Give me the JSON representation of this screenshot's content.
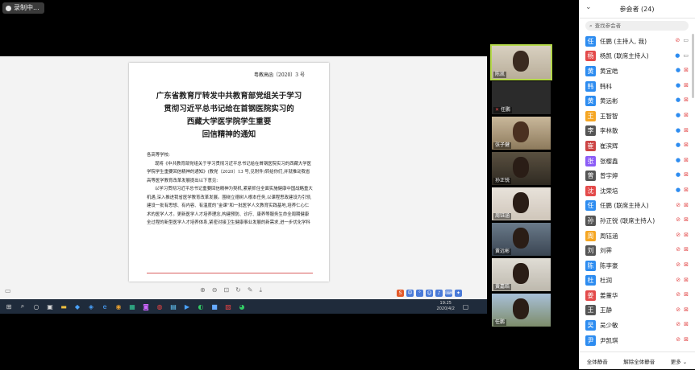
{
  "recording": {
    "label": "录制中..."
  },
  "document": {
    "number": "粤教高函〔2020〕3 号",
    "title": [
      "广东省教育厅转发中共教育部党组关于学习",
      "贯彻习近平总书记给在首钢医院实习的",
      "西藏大学医学院学生重要",
      "回信精神的通知"
    ],
    "salutation": "各高等学校:",
    "paragraphs": [
      "现将《中共教育部党组关于学习贯彻习近平总书记给在首钢医院实习的西藏大学医学院学生重要回信精神的通知》(教党〔2020〕13 号,见附件)转给你们,并就推动我省高等医学教育改革发展提出以下意见:",
      "以学习贯彻习近平总书记重要回信精神为契机,紧紧抓住全面实施健康中国战略重大机遇,深入推进我省医学教育改革发展。围绕立德树人根本任务,以课程思政建设为引领,建设一批有思想、有内容、有温度的“金课”和一批医学人文教育实践基地,培养仁心仁术的医学人才。更新医学人才培养理念,构建预防、诊疗、康养等服务生命全周期健康全过程的新型医学人才培养体系,紧密对接卫生健康事业发展的新需求,进一步优化学科"
    ]
  },
  "tray": {
    "time": "19:25",
    "date": "2020/4/2"
  },
  "videos": [
    {
      "name": "陈凯",
      "speaking": true
    },
    {
      "name": "任鹏",
      "speaking": false
    },
    {
      "name": "张子健",
      "speaking": false
    },
    {
      "name": "孙正锐",
      "speaking": false
    },
    {
      "name": "周钰涵",
      "speaking": false
    },
    {
      "name": "黄远彬",
      "speaking": false
    },
    {
      "name": "黄嘉皓",
      "speaking": false
    },
    {
      "name": "任鹏",
      "speaking": false
    }
  ],
  "panel": {
    "title": "参会者 (24)",
    "search_placeholder": "查找参会者",
    "participants": [
      {
        "avatar": "任",
        "name": "任鹏 (主持人, 我)",
        "color": "#2d8cf0",
        "mic": "muted",
        "cam": "on"
      },
      {
        "avatar": "杨",
        "name": "杨凯 (联席主持人)",
        "color": "#e34a4a",
        "mic": "on",
        "cam": "on"
      },
      {
        "avatar": "黄",
        "name": "黄宜皓",
        "color": "#2d8cf0",
        "mic": "on",
        "cam": "off"
      },
      {
        "avatar": "韩",
        "name": "韩科",
        "color": "#2d8cf0",
        "mic": "on",
        "cam": "off"
      },
      {
        "avatar": "黄",
        "name": "黄远彬",
        "color": "#2d8cf0",
        "mic": "on",
        "cam": "off"
      },
      {
        "avatar": "王",
        "name": "王智智",
        "color": "#f5a623",
        "mic": "on",
        "cam": "off"
      },
      {
        "avatar": "李",
        "name": "李林散",
        "color": "#555",
        "mic": "on",
        "cam": "off"
      },
      {
        "avatar": "崔",
        "name": "崔滨辉",
        "color": "#c44",
        "mic": "on",
        "cam": "off"
      },
      {
        "avatar": "张",
        "name": "张樱鑫",
        "color": "#8b5cf6",
        "mic": "on",
        "cam": "off"
      },
      {
        "avatar": "曾",
        "name": "曾宇婷",
        "color": "#555",
        "mic": "on",
        "cam": "off"
      },
      {
        "avatar": "沈",
        "name": "沈荣培",
        "color": "#e34a4a",
        "mic": "on",
        "cam": "off"
      },
      {
        "avatar": "任",
        "name": "任鹏 (联席主持人)",
        "color": "#2d8cf0",
        "mic": "muted",
        "cam": "off"
      },
      {
        "avatar": "孙",
        "name": "孙正锐 (联席主持人)",
        "color": "#555",
        "mic": "muted",
        "cam": "off"
      },
      {
        "avatar": "周",
        "name": "周钰涵",
        "color": "#f5a623",
        "mic": "muted",
        "cam": "off"
      },
      {
        "avatar": "刘",
        "name": "刘霁",
        "color": "#555",
        "mic": "muted",
        "cam": "off"
      },
      {
        "avatar": "陈",
        "name": "陈李豪",
        "color": "#2d8cf0",
        "mic": "muted",
        "cam": "off"
      },
      {
        "avatar": "杜",
        "name": "杜润",
        "color": "#2d8cf0",
        "mic": "muted",
        "cam": "off"
      },
      {
        "avatar": "姜",
        "name": "姜董华",
        "color": "#e34a4a",
        "mic": "muted",
        "cam": "off"
      },
      {
        "avatar": "王",
        "name": "王静",
        "color": "#555",
        "mic": "muted",
        "cam": "off"
      },
      {
        "avatar": "吴",
        "name": "吴少敏",
        "color": "#2d8cf0",
        "mic": "muted",
        "cam": "off"
      },
      {
        "avatar": "尹",
        "name": "尹凯琪",
        "color": "#2d8cf0",
        "mic": "muted",
        "cam": "off"
      }
    ],
    "footer": {
      "mute_all": "全体静音",
      "unmute_all": "解除全体静音",
      "more": "更多 ⌄"
    }
  }
}
